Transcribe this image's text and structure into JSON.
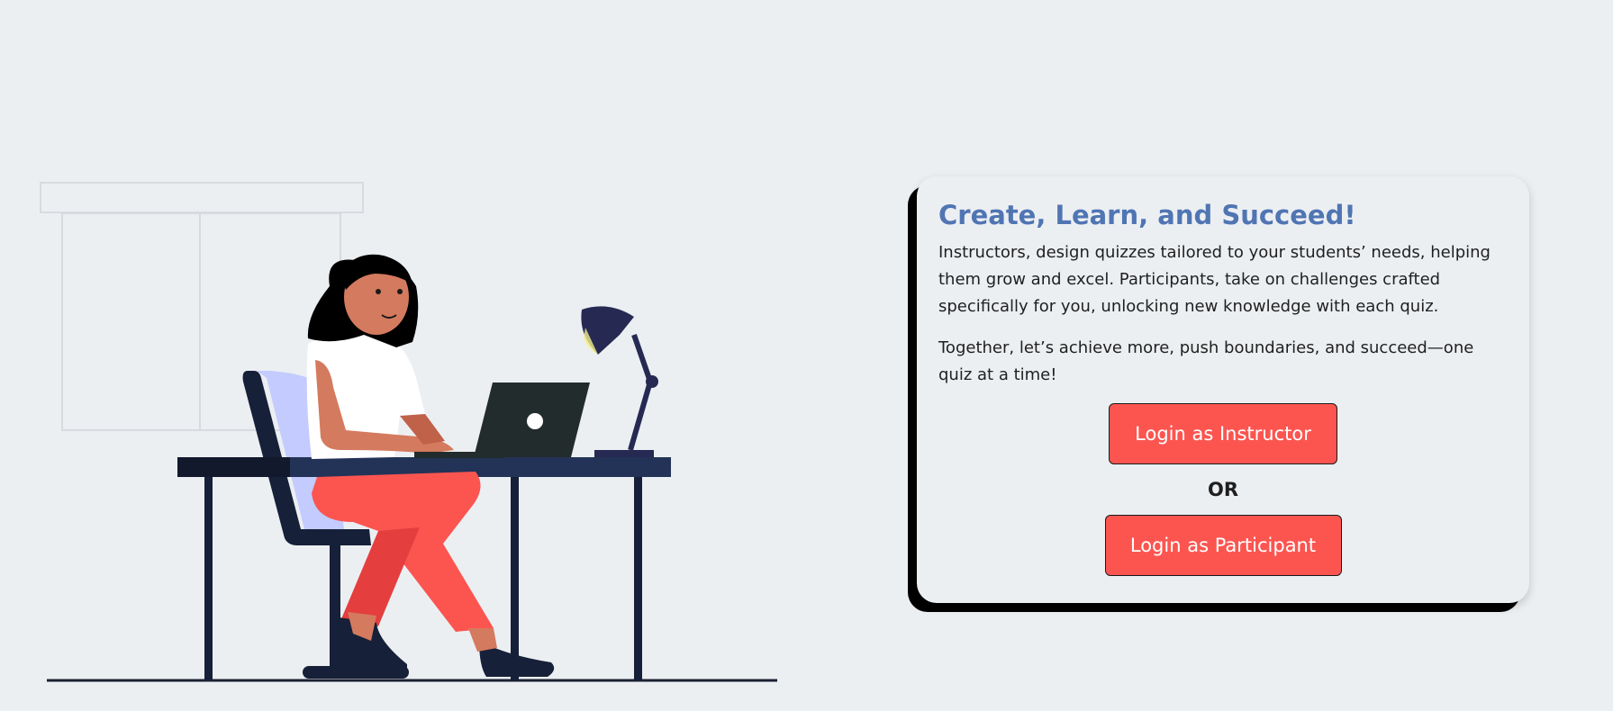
{
  "card": {
    "title": "Create, Learn, and Succeed!",
    "paragraph1": "Instructors, design quizzes tailored to your students’ needs, helping them grow and excel. Participants, take on challenges crafted specifically for you, unlocking new knowledge with each quiz.",
    "paragraph2": "Together, let’s achieve more, push boundaries, and succeed—one quiz at a time!",
    "instructor_button_label": "Login as Instructor",
    "or_label": "OR",
    "participant_button_label": "Login as Participant"
  },
  "colors": {
    "background": "#eceff2",
    "title": "#5075b3",
    "button": "#fc5550",
    "card_shadow": "#000000",
    "desk": "#233357",
    "pants": "#fc5550",
    "chair_cushion": "#c3cbff",
    "laptop": "#232c2c",
    "lamp": "#262a52",
    "skin": "#d47a5e"
  },
  "icons": {
    "illustration": "woman-working-at-desk-illustration"
  }
}
